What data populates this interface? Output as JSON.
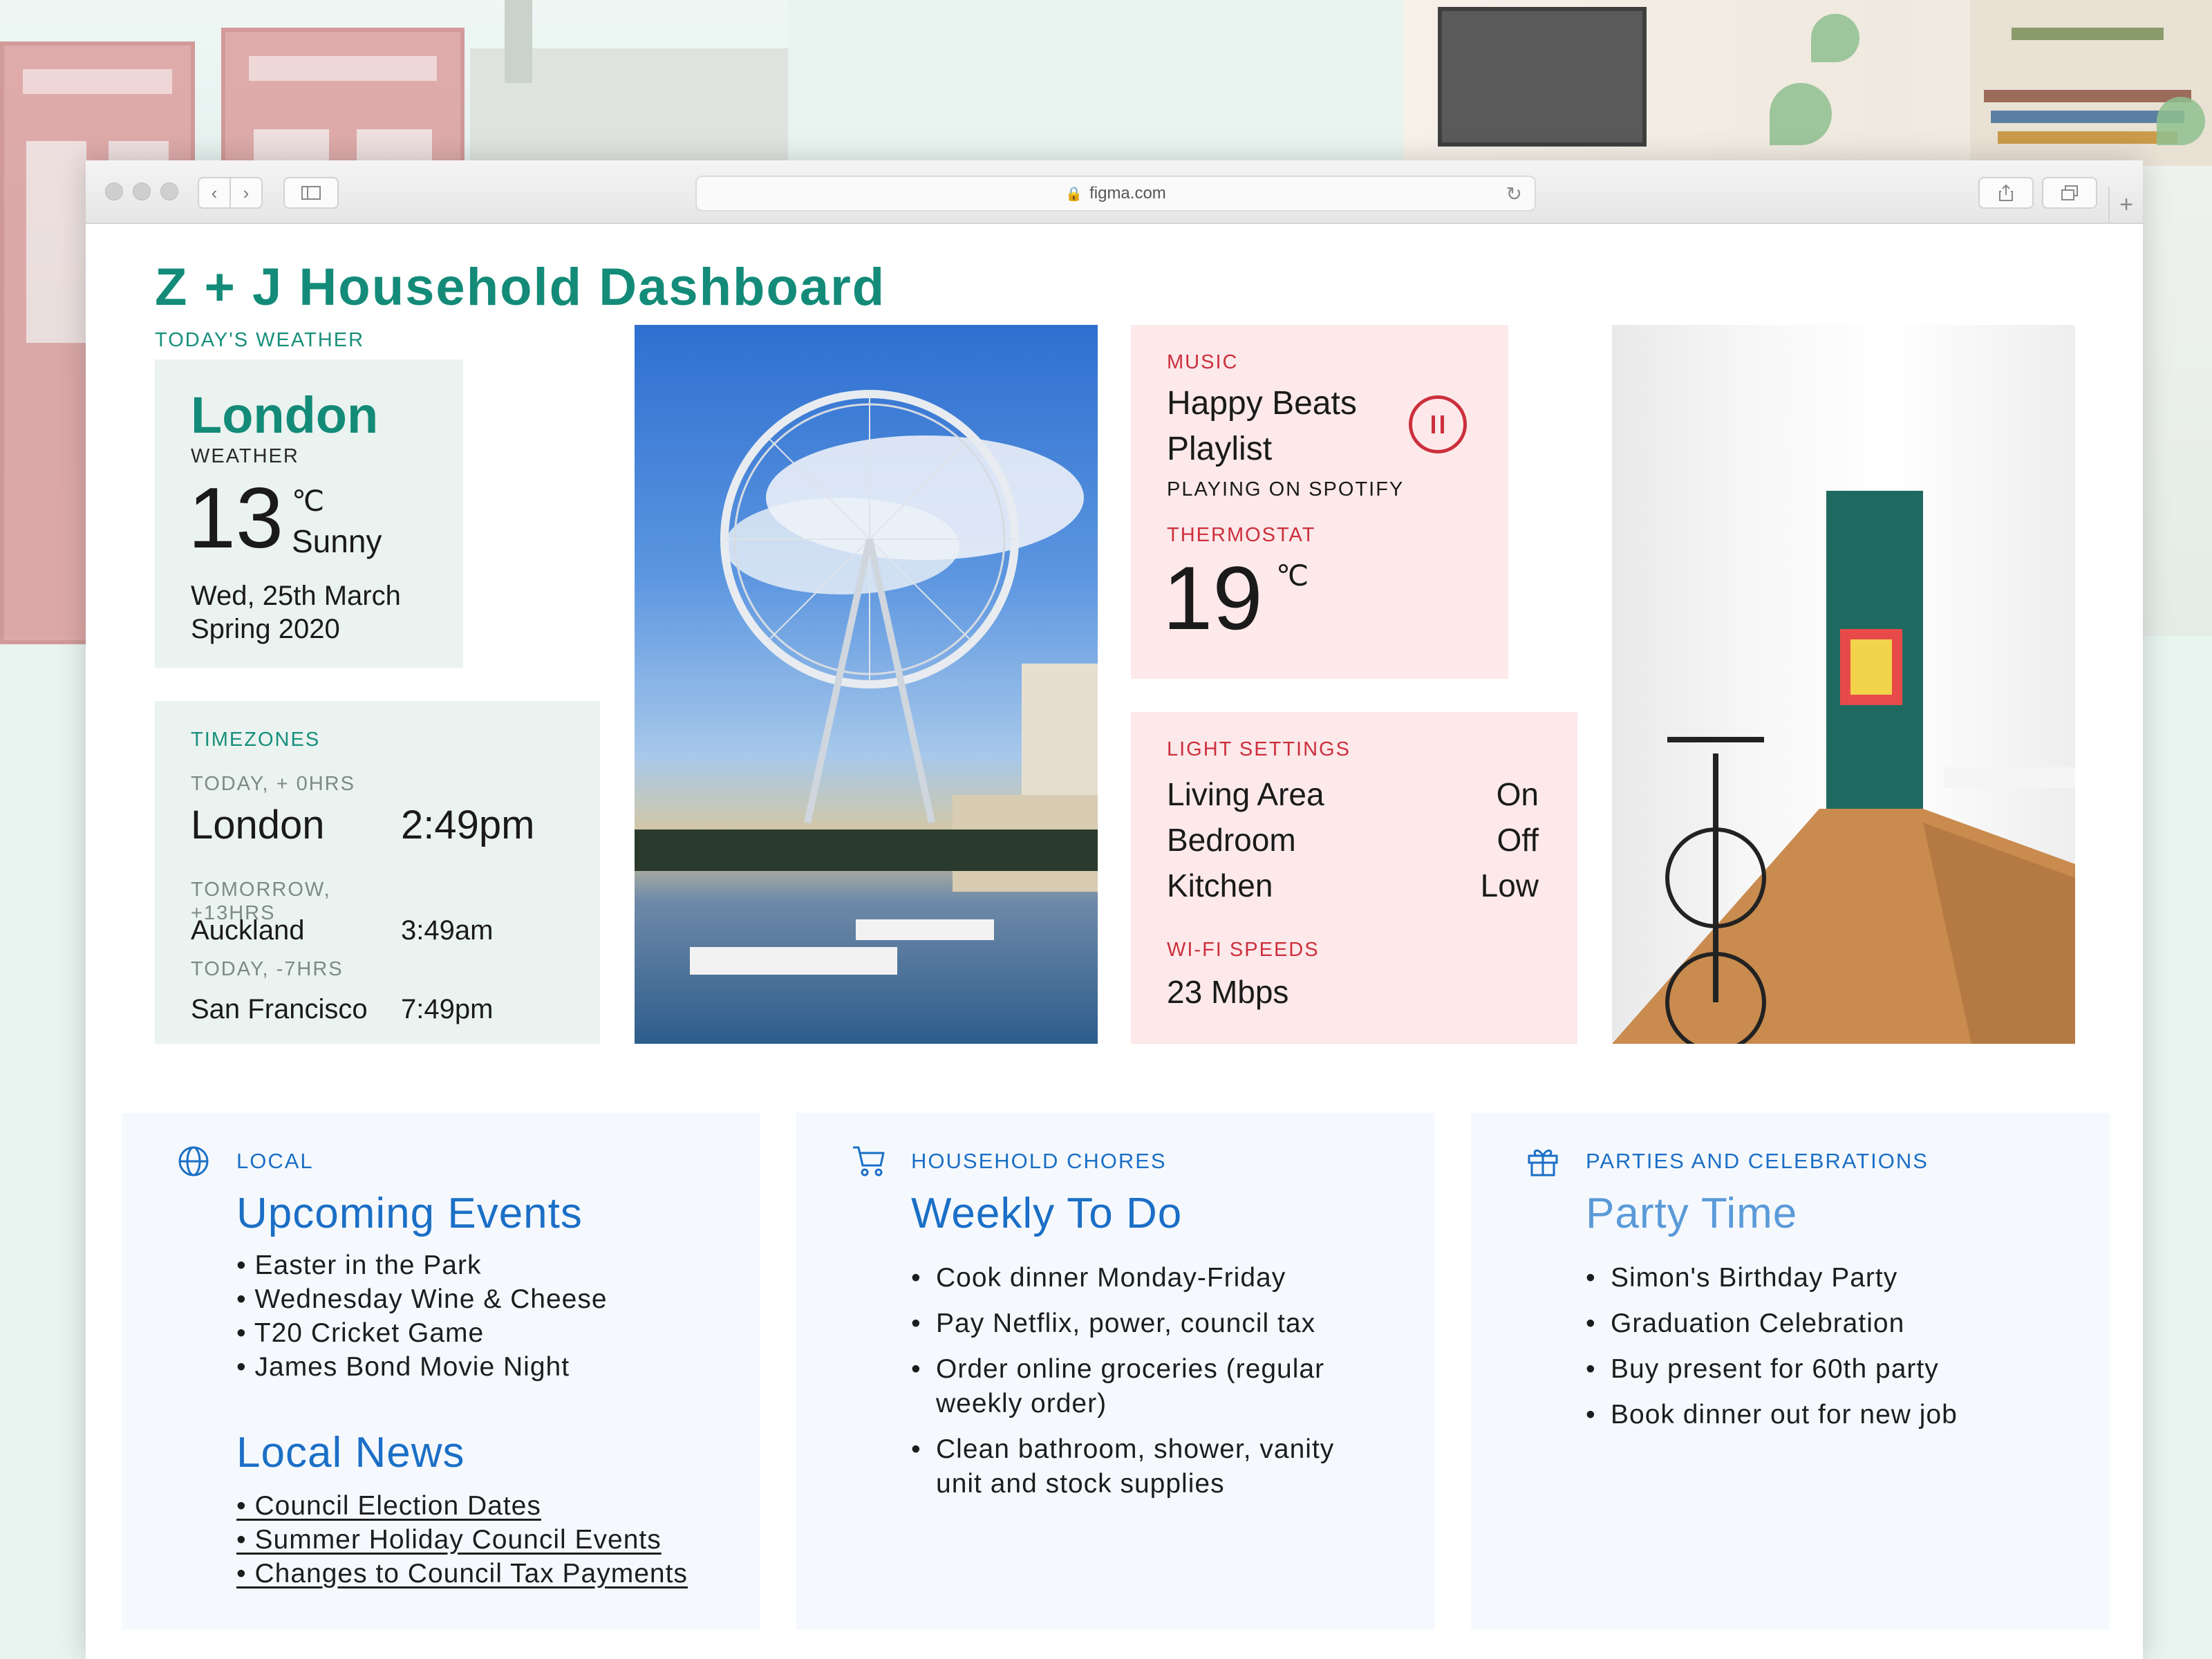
{
  "browser": {
    "url": "figma.com"
  },
  "page": {
    "title": "Z + J Household Dashboard"
  },
  "weather": {
    "section_label": "TODAY'S WEATHER",
    "city": "London",
    "sub_label": "WEATHER",
    "temp": "13",
    "unit": "℃",
    "condition": "Sunny",
    "date": "Wed, 25th March",
    "season": "Spring 2020"
  },
  "timezones": {
    "label": "TIMEZONES",
    "rows": [
      {
        "offset": "TODAY, + 0HRS",
        "city": "London",
        "time": "2:49pm"
      },
      {
        "offset": "TOMORROW, +13HRS",
        "city": "Auckland",
        "time": "3:49am"
      },
      {
        "offset": "TODAY, -7HRS",
        "city": "San Francisco",
        "time": "7:49pm"
      }
    ]
  },
  "music": {
    "label": "MUSIC",
    "title_line1": "Happy Beats",
    "title_line2": "Playlist",
    "source": "PLAYING ON SPOTIFY"
  },
  "thermostat": {
    "label": "THERMOSTAT",
    "temp": "19",
    "unit": "℃"
  },
  "lights": {
    "label": "LIGHT SETTINGS",
    "rows": [
      {
        "room": "Living Area",
        "state": "On"
      },
      {
        "room": "Bedroom",
        "state": "Off"
      },
      {
        "room": "Kitchen",
        "state": "Low"
      }
    ]
  },
  "wifi": {
    "label": "WI-FI SPEEDS",
    "speed": "23 Mbps"
  },
  "local": {
    "label": "LOCAL",
    "events_title": "Upcoming Events",
    "events": [
      "Easter in the Park",
      "Wednesday Wine & Cheese",
      "T20 Cricket Game",
      "James Bond Movie Night"
    ],
    "news_title": "Local News",
    "news": [
      "Council Election Dates",
      "Summer Holiday Council Events",
      "Changes to Council Tax Payments"
    ]
  },
  "chores": {
    "label": "HOUSEHOLD CHORES",
    "title": "Weekly To Do",
    "items": [
      "Cook dinner Monday-Friday",
      "Pay Netflix, power, council  tax",
      "Order online groceries (regular weekly order)",
      "Clean bathroom, shower, vanity unit and stock supplies"
    ]
  },
  "parties": {
    "label": "PARTIES AND CELEBRATIONS",
    "title": "Party Time",
    "items": [
      "Simon's Birthday Party",
      "Graduation Celebration",
      "Buy present for 60th party",
      "Book dinner out for new job"
    ]
  },
  "colors": {
    "green_accent": "#138b78",
    "red_accent": "#cc2f3d",
    "blue_accent": "#1b6fc6",
    "party_title": "#5b9ad8"
  },
  "icons": {
    "local": "globe-icon",
    "chores": "cart-icon",
    "parties": "gift-icon",
    "music_control": "pause-icon"
  }
}
